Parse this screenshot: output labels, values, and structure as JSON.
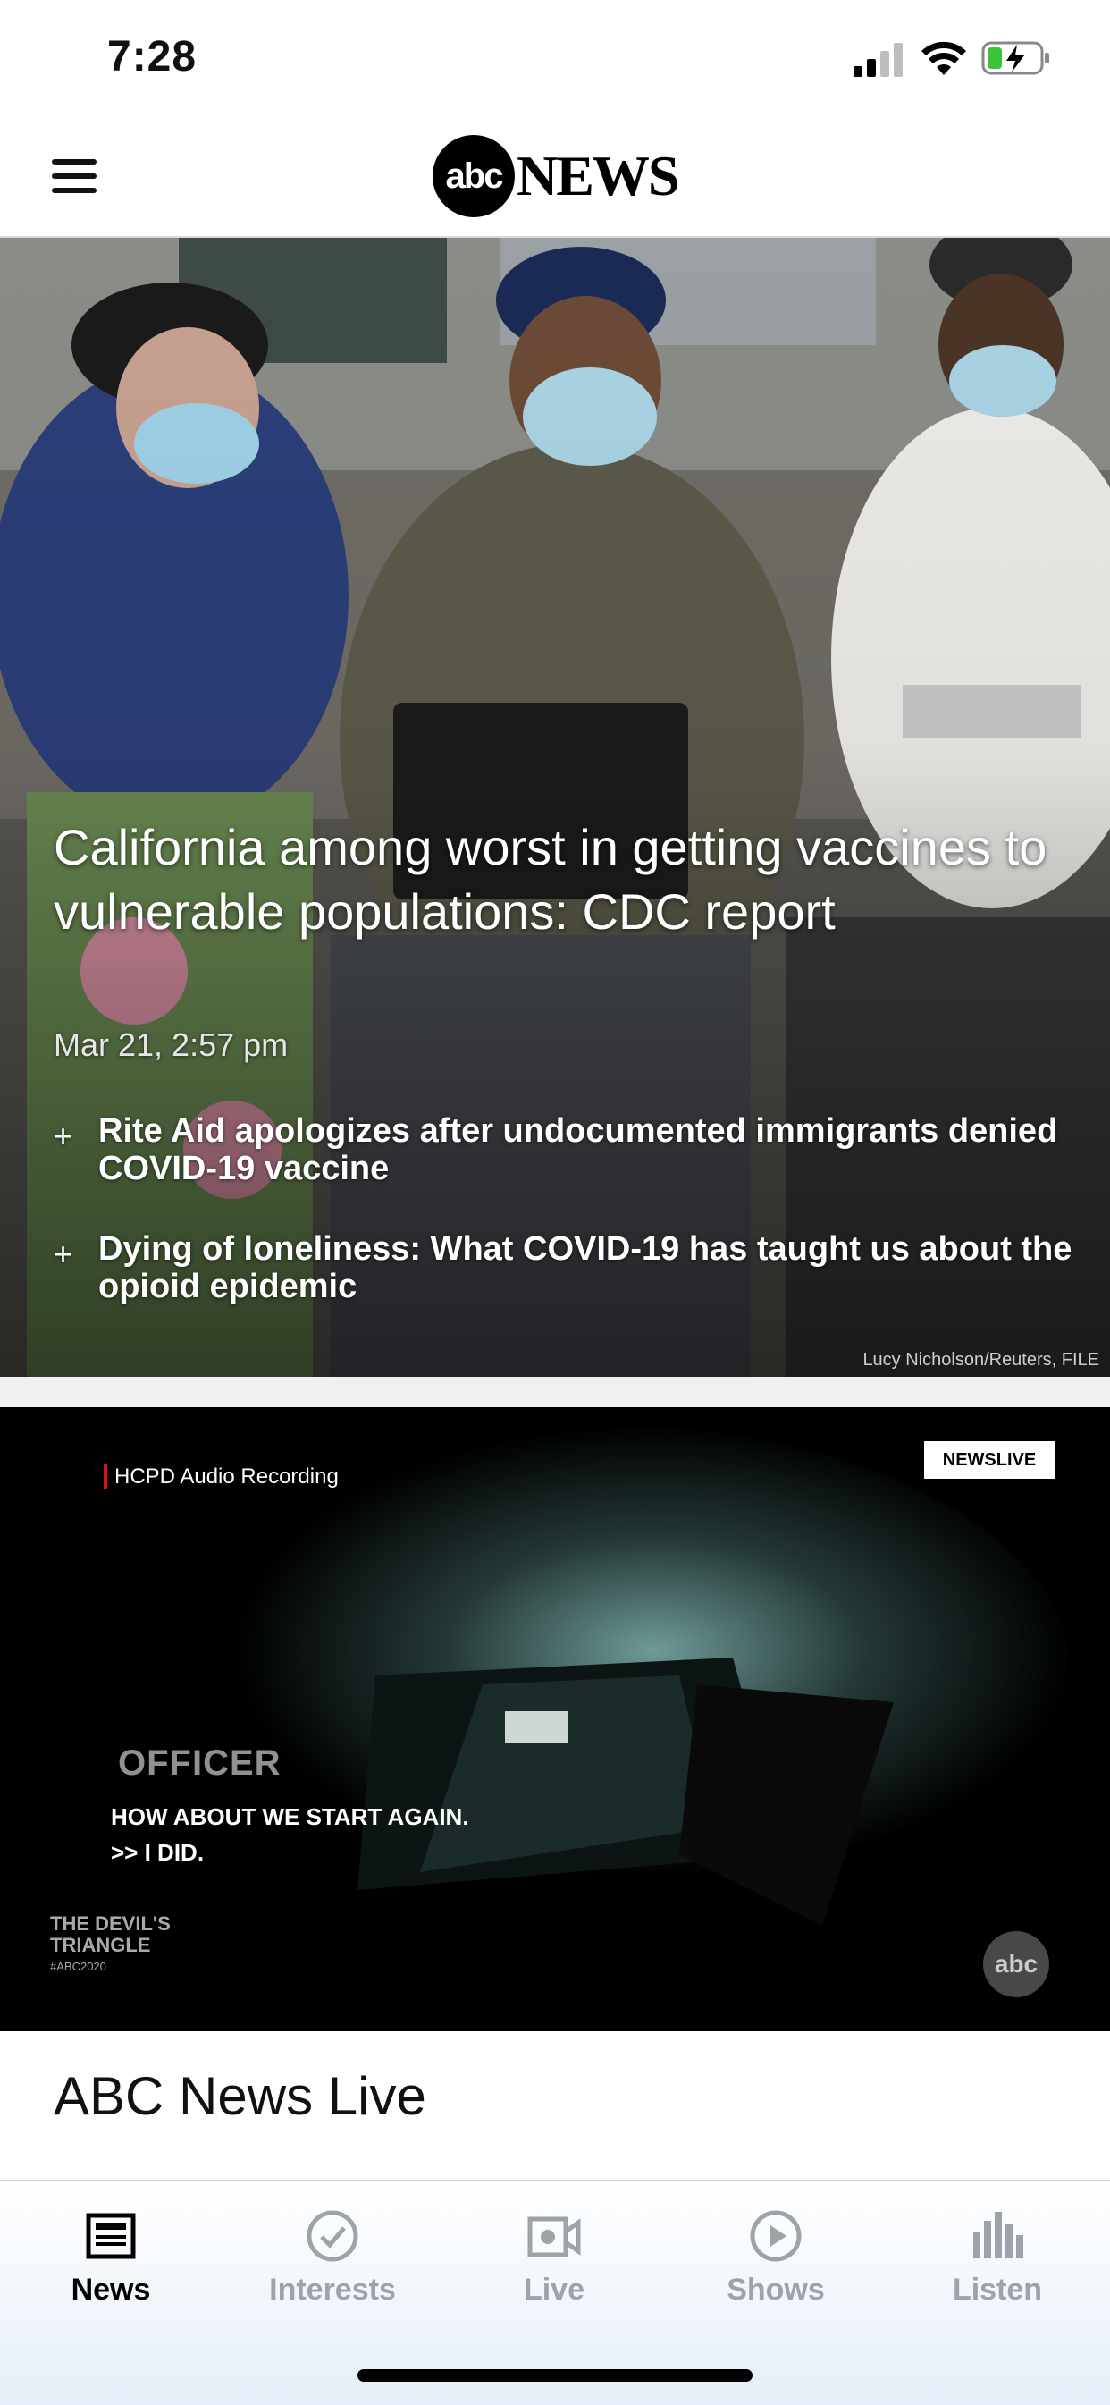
{
  "status_bar": {
    "time": "7:28"
  },
  "header": {
    "logo_abc": "abc",
    "logo_news": "NEWS"
  },
  "hero": {
    "headline": "California among worst in getting vaccines to vulnerable populations: CDC report",
    "timestamp": "Mar 21, 2:57 pm",
    "related": [
      {
        "plus": "+",
        "title": "Rite Aid apologizes after undocumented immigrants denied COVID-19 vaccine"
      },
      {
        "plus": "+",
        "title": "Dying of loneliness: What COVID-19 has taught us about the opioid epidemic"
      }
    ],
    "photo_credit": "Lucy Nicholson/Reuters, FILE"
  },
  "video": {
    "recording_label": "HCPD Audio Recording",
    "live_badge": "NEWSLIVE",
    "speaker": "OFFICER",
    "caption_line1": "HOW ABOUT WE START AGAIN.",
    "caption_line2": ">> I DID.",
    "show_logo_line1": "THE DEVIL'S",
    "show_logo_line2": "TRIANGLE",
    "show_logo_tag": "#ABC2020",
    "watermark": "abc"
  },
  "section": {
    "title": "ABC News Live"
  },
  "tabs": [
    {
      "label": "News",
      "icon": "newspaper-icon",
      "active": true
    },
    {
      "label": "Interests",
      "icon": "checkmark-circle-icon",
      "active": false
    },
    {
      "label": "Live",
      "icon": "video-camera-icon",
      "active": false
    },
    {
      "label": "Shows",
      "icon": "play-circle-icon",
      "active": false
    },
    {
      "label": "Listen",
      "icon": "audio-bars-icon",
      "active": false
    }
  ],
  "colors": {
    "accent_red": "#dd1111",
    "inactive_tab": "#9da3ab"
  }
}
